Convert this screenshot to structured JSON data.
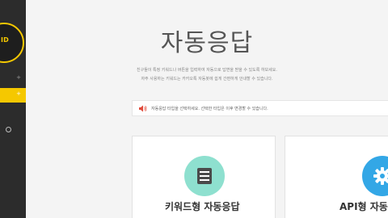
{
  "sidebar": {
    "logo_text": "ID",
    "expand_symbol": "+",
    "active_expand_symbol": "+"
  },
  "main": {
    "title": "자동응답",
    "description_line1": "친구들이 특정 키워드나 버튼을 입력하여 자동으로 답변을 받을 수 있도록 하보세요.",
    "description_line2": "자주 사용하는 키워드는 카카오톡 자동봇에 쉽게 간편하게 안내할 수 있습니다.",
    "notice_text": "자동응답 타입을 선택하세요. 선택한 타입은 이후 변경할 수 있습니다.",
    "notice_icon": "speaker-icon",
    "accent_color": "#f5c800",
    "cards": [
      {
        "label": "키워드형 자동응답",
        "icon": "document-icon",
        "color": "#8ee0cf"
      },
      {
        "label": "API형 자동응답",
        "icon": "gear-icon",
        "color": "#33a7e6"
      }
    ]
  }
}
